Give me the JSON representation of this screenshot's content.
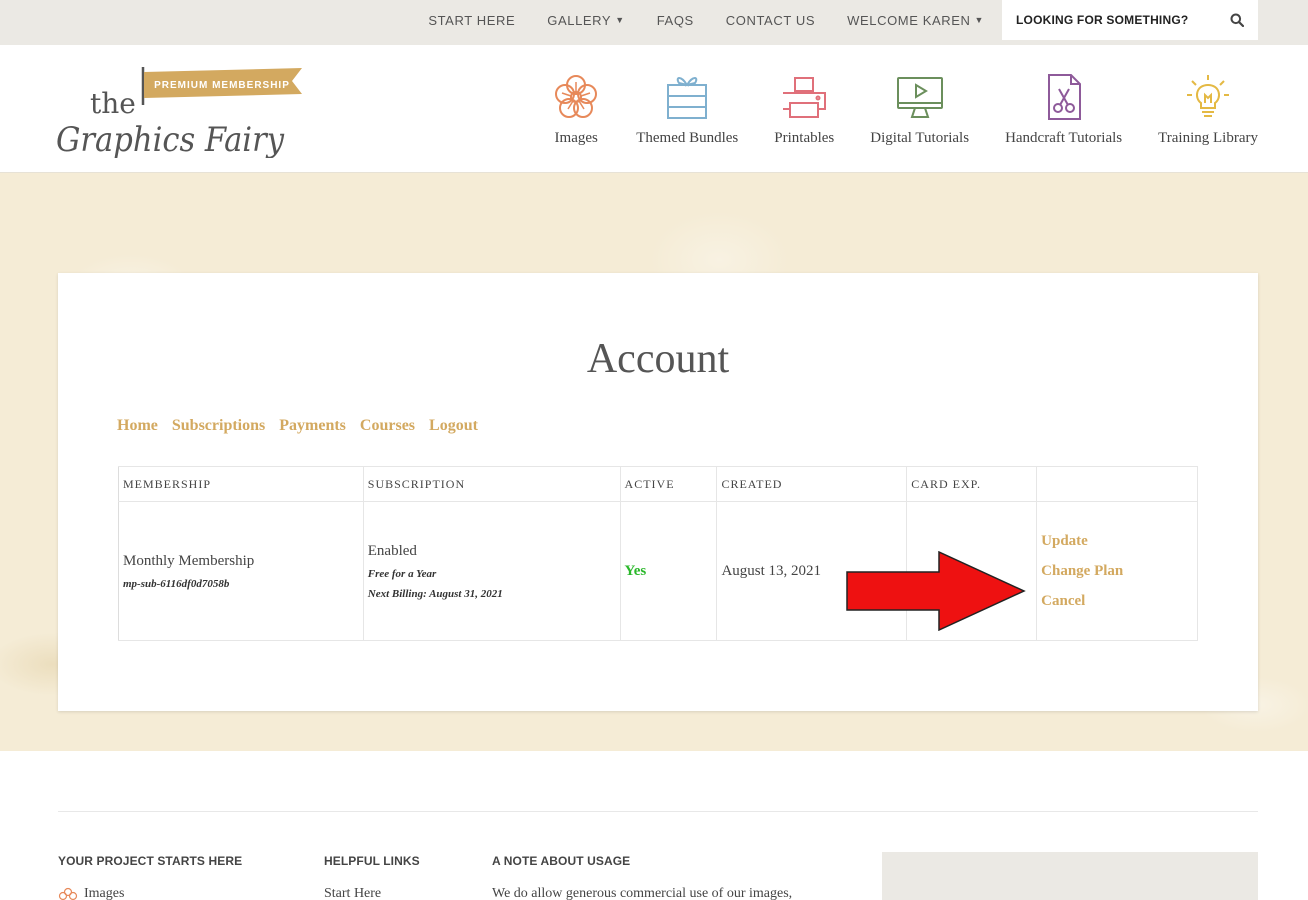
{
  "topbar": {
    "nav": [
      {
        "label": "START HERE",
        "dropdown": false
      },
      {
        "label": "GALLERY",
        "dropdown": true
      },
      {
        "label": "FAQS",
        "dropdown": false
      },
      {
        "label": "CONTACT US",
        "dropdown": false
      },
      {
        "label": "WELCOME KAREN",
        "dropdown": true
      }
    ],
    "search_placeholder": "LOOKING FOR SOMETHING?"
  },
  "logo": {
    "banner": "PREMIUM MEMBERSHIP",
    "word1": "the",
    "word2": "Graphics Fairy"
  },
  "categories": [
    {
      "label": "Images",
      "icon": "flower-icon",
      "color": "#e7895a"
    },
    {
      "label": "Themed Bundles",
      "icon": "gift-box-icon",
      "color": "#7fb0cf"
    },
    {
      "label": "Printables",
      "icon": "printer-icon",
      "color": "#e0707a"
    },
    {
      "label": "Digital Tutorials",
      "icon": "monitor-play-icon",
      "color": "#6b8f5c"
    },
    {
      "label": "Handcraft Tutorials",
      "icon": "scissors-doc-icon",
      "color": "#8e5a9a"
    },
    {
      "label": "Training Library",
      "icon": "lightbulb-icon",
      "color": "#e4b944"
    }
  ],
  "account": {
    "title": "Account",
    "nav": [
      "Home",
      "Subscriptions",
      "Payments",
      "Courses",
      "Logout"
    ],
    "columns": [
      "MEMBERSHIP",
      "SUBSCRIPTION",
      "ACTIVE",
      "CREATED",
      "CARD EXP."
    ],
    "row": {
      "membership": "Monthly Membership",
      "sub_id": "mp-sub-6116df0d7058b",
      "status": "Enabled",
      "note1": "Free for a Year",
      "note2": "Next Billing: August 31, 2021",
      "active": "Yes",
      "created": "August 13, 2021",
      "card_exp": "",
      "actions": [
        "Update",
        "Change Plan",
        "Cancel"
      ]
    }
  },
  "colors": {
    "accent": "#d3a960",
    "active": "#2bb82b",
    "arrow": "#ee1111"
  },
  "footer": {
    "col1_heading": "YOUR PROJECT STARTS HERE",
    "col1_link": "Images",
    "col2_heading": "HELPFUL LINKS",
    "col2_link": "Start Here",
    "col3_heading": "A NOTE ABOUT USAGE",
    "col3_text": "We do allow generous commercial use of our images,"
  }
}
